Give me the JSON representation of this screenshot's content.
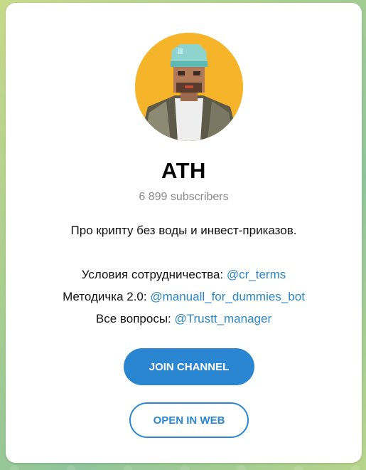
{
  "channel": {
    "name": "ATH",
    "subscribers": "6 899 subscribers",
    "description": {
      "tagline": "Про крипту без воды и инвест-приказов.",
      "lines": [
        {
          "label": "Условия сотрудничества: ",
          "link": "@cr_terms"
        },
        {
          "label": "Методичка 2.0: ",
          "link": "@manuall_for_dummies_bot"
        },
        {
          "label": "Все вопросы: ",
          "link": "@Trustt_manager"
        }
      ]
    }
  },
  "buttons": {
    "join_label": "JOIN CHANNEL",
    "web_label": "OPEN IN WEB"
  },
  "colors": {
    "accent": "#2a86d1",
    "link": "#2a86c8",
    "avatar_bg": "#f6b42a"
  },
  "avatar": {
    "icon": "channel-avatar-pixel-portrait"
  }
}
